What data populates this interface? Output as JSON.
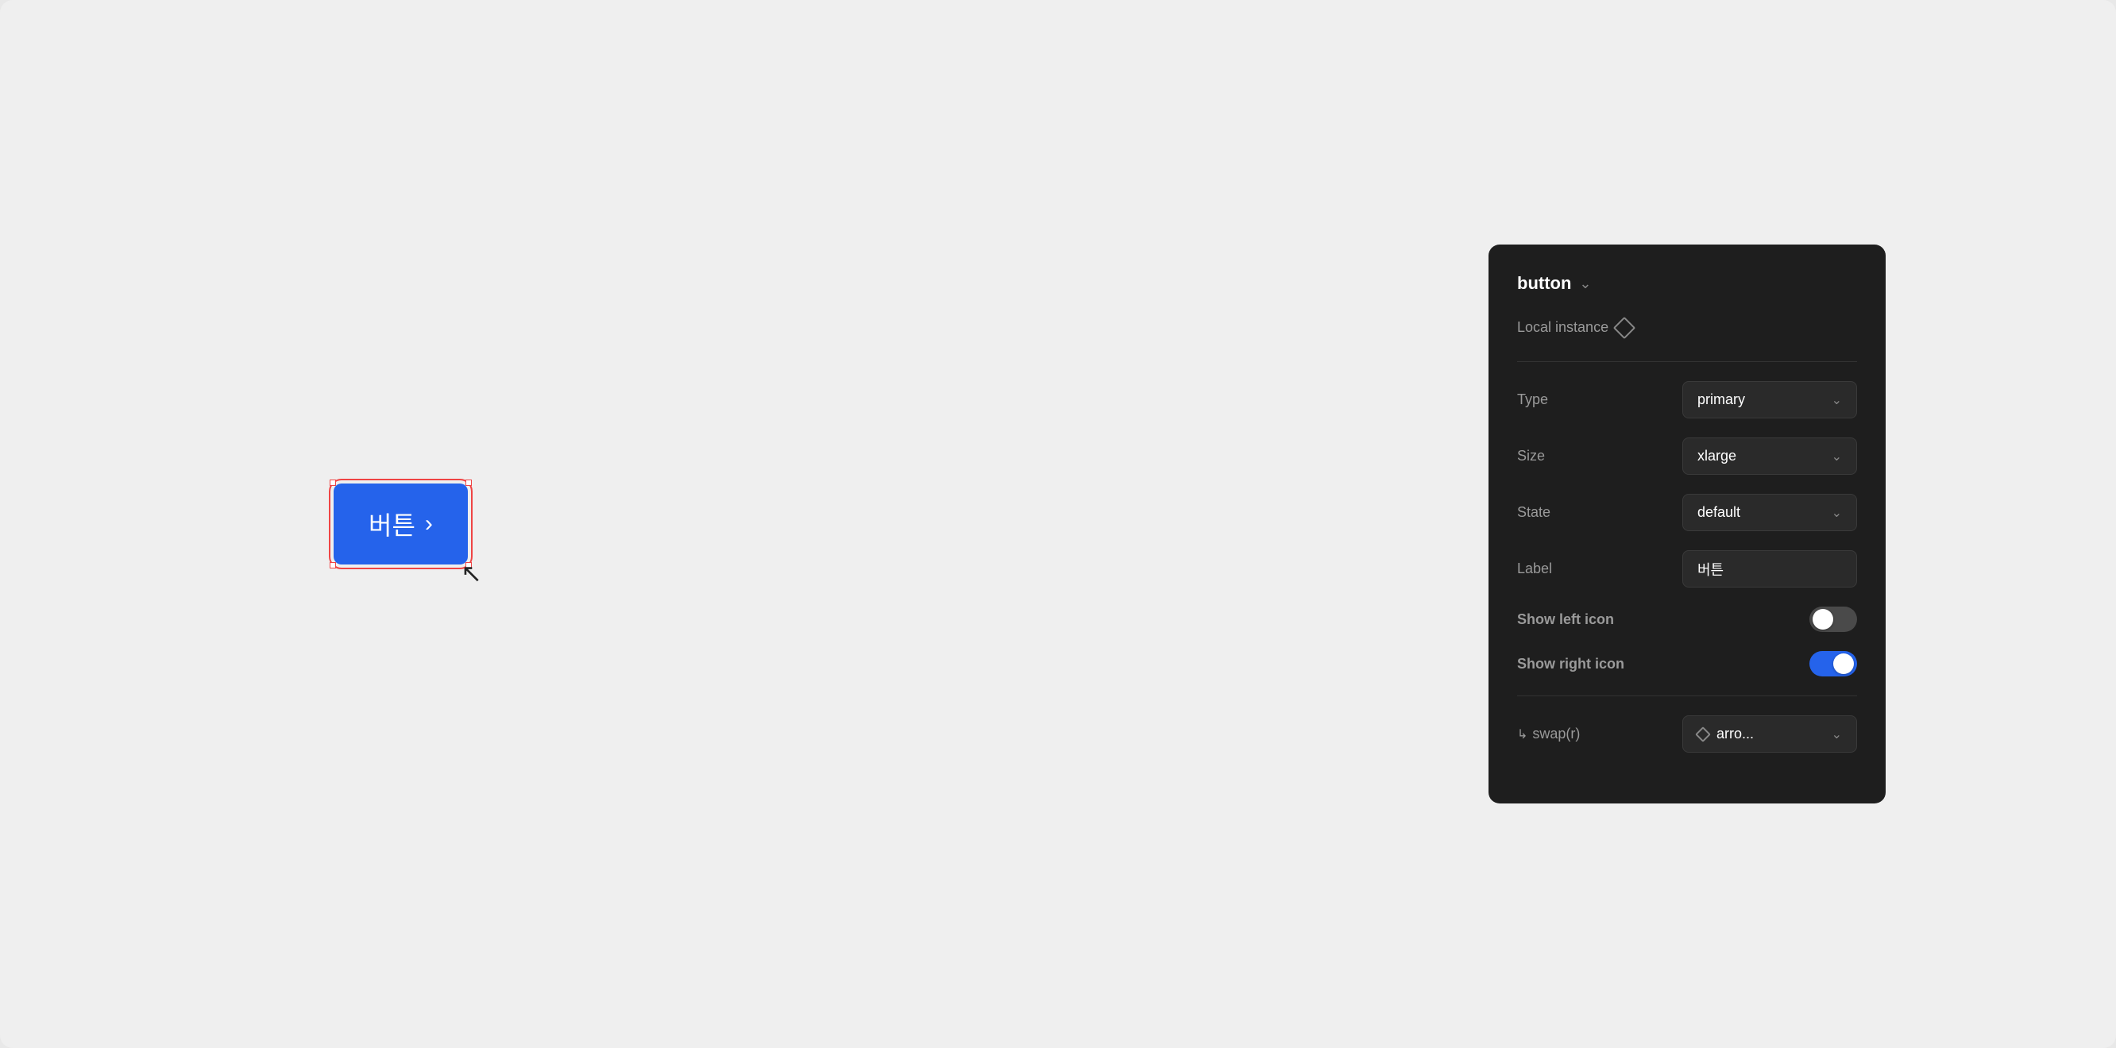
{
  "canvas": {
    "button_text": "버튼",
    "button_arrow": "›"
  },
  "panel": {
    "title": "button",
    "chevron": "∨",
    "local_instance_label": "Local instance",
    "properties": [
      {
        "id": "type",
        "label": "Type",
        "value": "primary",
        "kind": "dropdown"
      },
      {
        "id": "size",
        "label": "Size",
        "value": "xlarge",
        "kind": "dropdown"
      },
      {
        "id": "state",
        "label": "State",
        "value": "default",
        "kind": "dropdown"
      },
      {
        "id": "label",
        "label": "Label",
        "value": "버튼",
        "kind": "input"
      },
      {
        "id": "show_left_icon",
        "label": "Show left icon",
        "value": false,
        "kind": "toggle"
      },
      {
        "id": "show_right_icon",
        "label": "Show right icon",
        "value": true,
        "kind": "toggle"
      }
    ],
    "swap_label": "↳ swap(r)",
    "swap_value": "arro...",
    "chevron_symbol": "⌄"
  }
}
